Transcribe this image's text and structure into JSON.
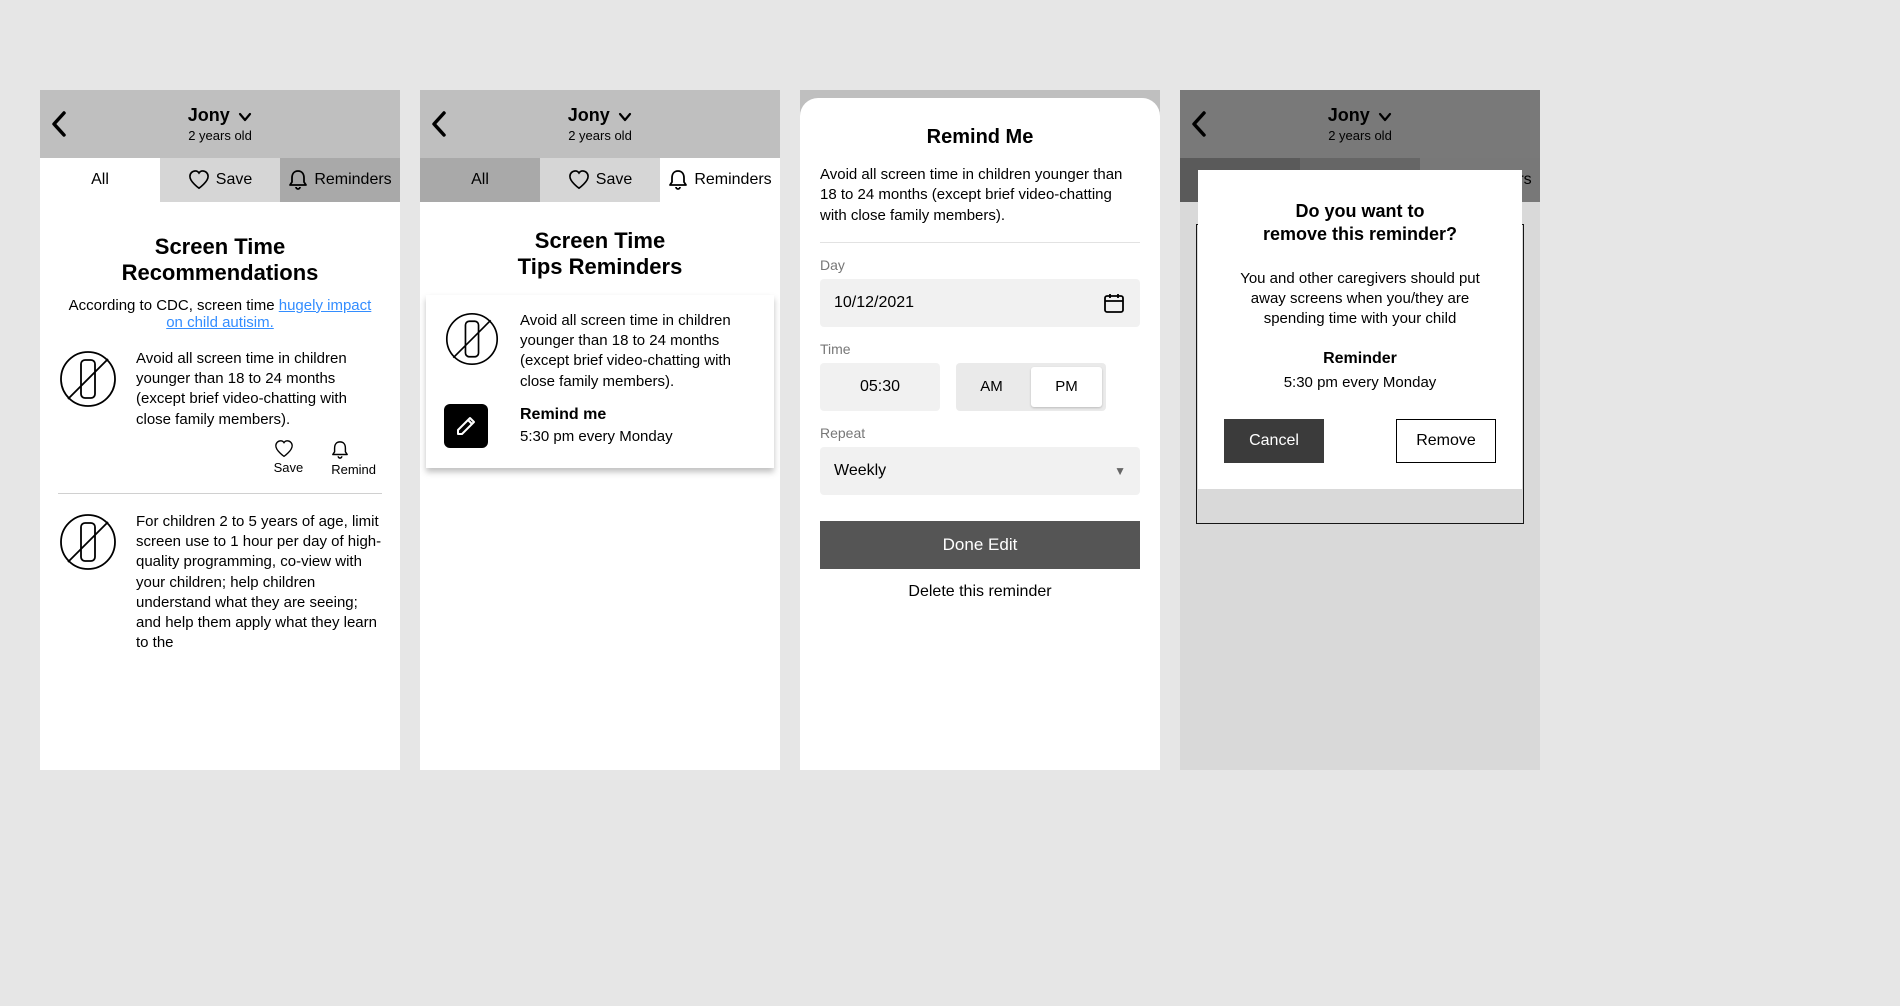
{
  "header": {
    "child_name": "Jony",
    "child_age": "2 years old"
  },
  "tabs": {
    "all": "All",
    "save": "Save",
    "reminders": "Reminders"
  },
  "screen1": {
    "title_line1": "Screen Time",
    "title_line2": "Recommendations",
    "intro_prefix": "According to CDC, screen time ",
    "intro_link": "hugely impact on child autisim.",
    "tip1": "Avoid all screen time in children younger than 18 to 24 months (except brief video-chatting with close family members).",
    "action_save": "Save",
    "action_remind": "Remind",
    "tip2": "For children 2 to 5 years of age, limit screen use to 1 hour per day of high-quality programming, co-view with your children; help children understand what they are seeing; and help them apply what they learn to the"
  },
  "screen2": {
    "title_line1": "Screen Time",
    "title_line2": "Tips Reminders",
    "card_text": "Avoid all screen time in children younger than 18 to 24 months (except brief video-chatting with close family members).",
    "remind_label": "Remind me",
    "remind_time": "5:30 pm every Monday"
  },
  "screen3": {
    "title": "Remind Me",
    "desc": "Avoid all screen time in children younger than 18 to 24 months (except brief video-chatting with close family members).",
    "day_label": "Day",
    "day_value": "10/12/2021",
    "time_label": "Time",
    "time_value": "05:30",
    "am": "AM",
    "pm": "PM",
    "repeat_label": "Repeat",
    "repeat_value": "Weekly",
    "done": "Done Edit",
    "delete": "Delete this reminder"
  },
  "screen4": {
    "question_l1": "Do you want to",
    "question_l2": "remove this reminder?",
    "body": "You and other caregivers should put away screens when you/they are spending time with your child",
    "sub": "Reminder",
    "when": "5:30 pm every Monday",
    "cancel": "Cancel",
    "remove": "Remove"
  }
}
